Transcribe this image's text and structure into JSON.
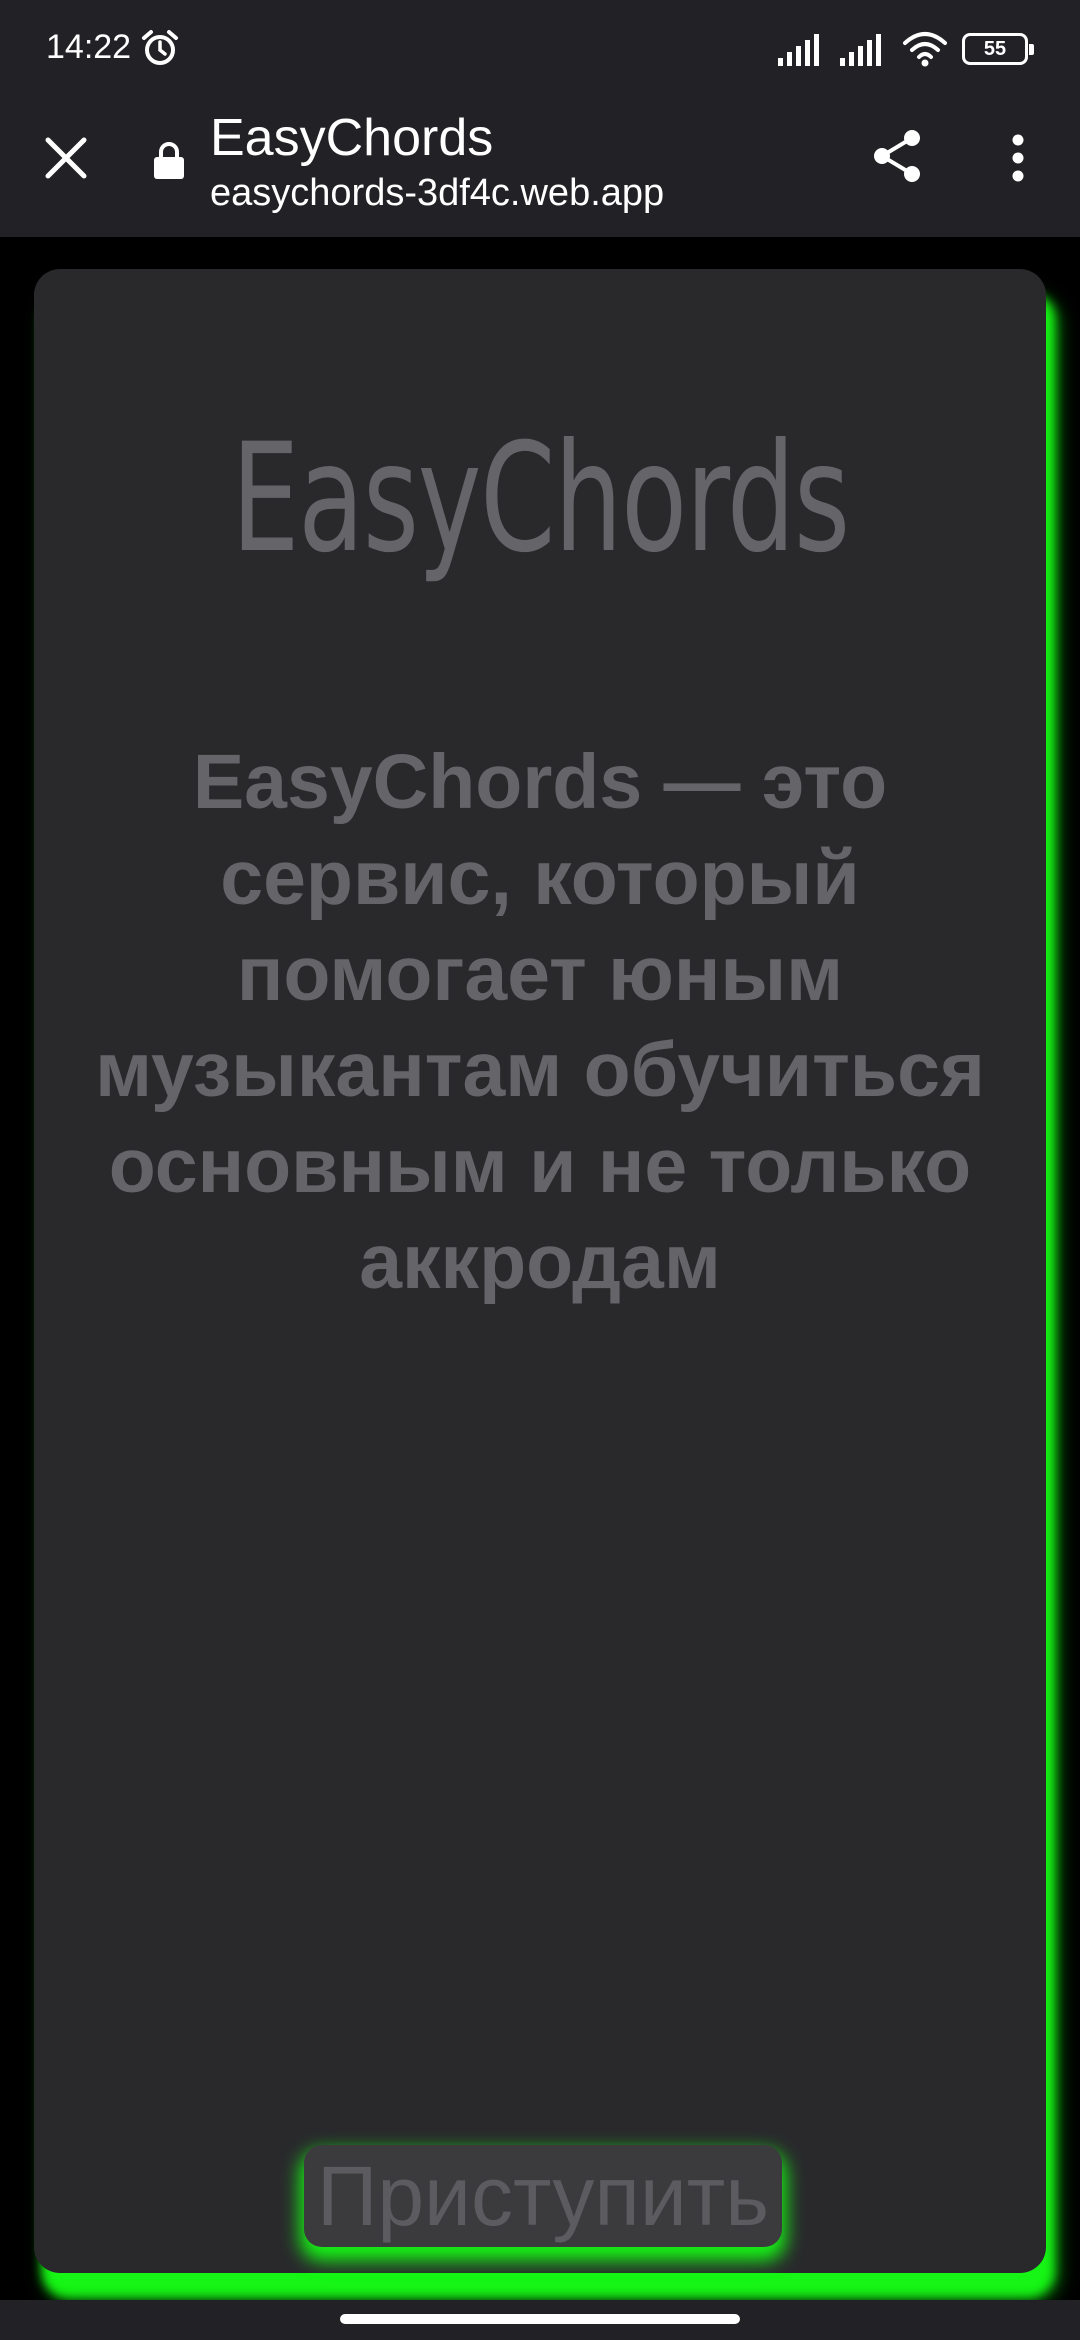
{
  "status_bar": {
    "time": "14:22",
    "battery_level": "55",
    "icons": [
      "alarm-icon",
      "signal-icon",
      "signal-icon",
      "wifi-icon",
      "battery-icon"
    ]
  },
  "browser": {
    "title": "EasyChords",
    "url": "easychords-3df4c.web.app",
    "icons": [
      "close-icon",
      "lock-icon",
      "share-icon",
      "more-vert-icon"
    ]
  },
  "page": {
    "logo_text": "EasyChords",
    "description": "EasyChords — это сервис, который помогает юным музыкантам обучиться основным и не только аккродам",
    "start_button_label": "Приступить"
  },
  "colors": {
    "card_background": "#29292c",
    "text_gray": "#656569",
    "glow_green": "#16f515",
    "bar_background": "#222226"
  }
}
